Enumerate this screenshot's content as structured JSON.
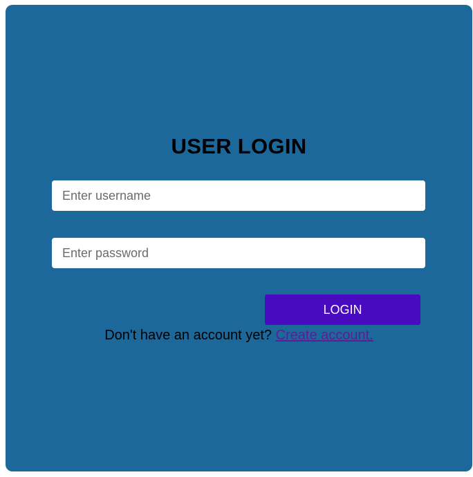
{
  "login": {
    "title": "USER LOGIN",
    "username_placeholder": "Enter username",
    "password_placeholder": "Enter password",
    "button_label": "LOGIN",
    "signup_prompt": "Don't have an account yet?",
    "signup_link": "Create account."
  },
  "colors": {
    "background": "#1c689b",
    "button": "#4a0abf",
    "link": "#5b1d94"
  }
}
